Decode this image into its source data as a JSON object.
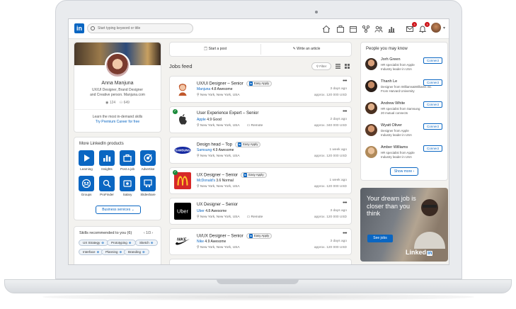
{
  "nav": {
    "search_placeholder": "Start typing keyword or title",
    "notification_count": "3"
  },
  "profile": {
    "name": "Anna Manjuna",
    "title_line1": "UX/UI Designer, Brand Designer",
    "title_line2": "and Creative person. Manjuna.com",
    "views": "124",
    "connections": "649",
    "cta_text": "Learn the most in-demand skills",
    "cta_link": "Try Premium Career for free"
  },
  "products": {
    "title": "More LinkedIn products",
    "items": [
      {
        "label": "Learning",
        "icon": "play-icon"
      },
      {
        "label": "Insights",
        "icon": "chart-icon"
      },
      {
        "label": "Post a job",
        "icon": "briefcase-icon"
      },
      {
        "label": "Advertise",
        "icon": "target-icon"
      },
      {
        "label": "Groups",
        "icon": "groups-icon"
      },
      {
        "label": "ProFinder",
        "icon": "profinder-icon"
      },
      {
        "label": "Salary",
        "icon": "salary-icon"
      },
      {
        "label": "Slideshare",
        "icon": "slideshare-icon"
      }
    ],
    "business_button": "Business services"
  },
  "skills": {
    "title": "Skills recommended to you (6)",
    "pager": "1/3",
    "chips": [
      "UX Strategy",
      "Prototyping",
      "Sketch",
      "Interface",
      "Planning",
      "Branding"
    ]
  },
  "share": {
    "post_label": "Start a post",
    "article_label": "Write an article"
  },
  "feed": {
    "title": "Jobs feed",
    "filter_label": "Filter",
    "easy_apply": "Easy Apply",
    "jobs": [
      {
        "title": "UX/UI Designer – Senior",
        "easy": true,
        "company": "Manjuna",
        "rating": "4.8 Awesome",
        "location": "New York, New York, USA",
        "remote": "",
        "ago": "3 days ago",
        "salary": "approx. 120 000 USD",
        "verified": false,
        "logo": "manjuna-logo"
      },
      {
        "title": "User Experience Expert – Senior",
        "easy": false,
        "company": "Apple",
        "rating": "4.9 Good",
        "location": "New York, New York, USA",
        "remote": "Remote",
        "ago": "2 days ago",
        "salary": "approx. 340 000 USD",
        "verified": true,
        "logo": "apple-logo"
      },
      {
        "title": "Design head – Top",
        "easy": true,
        "company": "Samsung",
        "rating": "4.9 Awesome",
        "location": "New York, New York, USA",
        "remote": "",
        "ago": "1 week ago",
        "salary": "approx. 120 000 USD",
        "verified": false,
        "logo": "samsung-logo"
      },
      {
        "title": "UX Designer – Senior",
        "easy": true,
        "company": "McDonald's",
        "rating": "3.6 Normal",
        "location": "New York, New York, USA",
        "remote": "",
        "ago": "1 week ago",
        "salary": "approx. 120 000 USD",
        "verified": true,
        "logo": "mcdonalds-logo"
      },
      {
        "title": "UX Designer – Senior",
        "easy": false,
        "company": "Uber",
        "rating": "4.8 Awesome",
        "location": "New York, New York, USA",
        "remote": "Remote",
        "ago": "3 days ago",
        "salary": "approx. 120 000 USD",
        "verified": false,
        "logo": "uber-logo"
      },
      {
        "title": "UI/UX Designer – Senior",
        "easy": true,
        "company": "Nike",
        "rating": "4.9 Awesome",
        "location": "New York, New York, USA",
        "remote": "",
        "ago": "3 days ago",
        "salary": "approx. 120 000 USD",
        "verified": false,
        "logo": "nike-logo"
      }
    ]
  },
  "people": {
    "title": "People you may know",
    "connect_label": "Connect",
    "show_more": "Show more",
    "items": [
      {
        "name": "Jorh Green",
        "line1": "HR specialist from Apple",
        "line2": "Industry leader in USA"
      },
      {
        "name": "Thanh Le",
        "line1": "Designer from Williams&Williams inc.",
        "line2": "From Harvard University"
      },
      {
        "name": "Andrew White",
        "line1": "HR specialist from Samsung",
        "line2": "20 mutual connects"
      },
      {
        "name": "Wyatt Oliver",
        "line1": "Designer from Apple",
        "line2": "Industry leader in USA"
      },
      {
        "name": "Amber Williams",
        "line1": "HR specialist from Apple",
        "line2": "Industry leader in USA"
      }
    ]
  },
  "ad": {
    "headline": "Your dream job is closer than you think",
    "button": "See jobs",
    "brand": "Linked",
    "brand_in": "in"
  },
  "colors": {
    "accent": "#0a66c2",
    "verified": "#1b8a3a",
    "notification": "#cc1016"
  }
}
